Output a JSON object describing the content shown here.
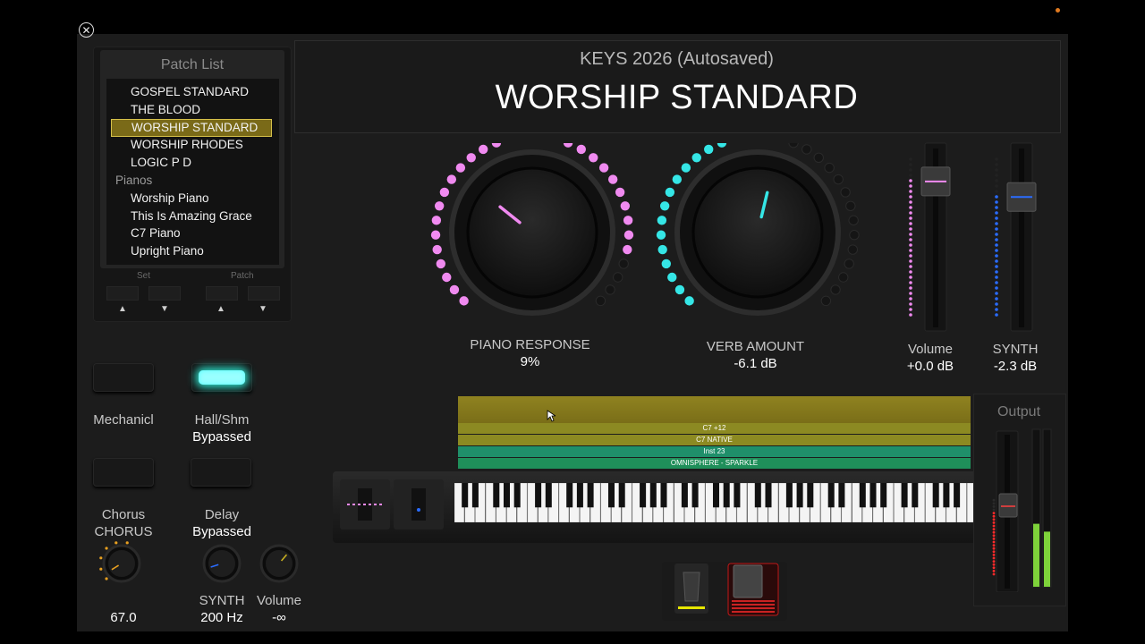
{
  "project_title": "KEYS 2026 (Autosaved)",
  "patch_name": "WORSHIP STANDARD",
  "patch_list": {
    "title": "Patch List",
    "items": [
      {
        "label": "GOSPEL STANDARD",
        "type": "item"
      },
      {
        "label": "THE BLOOD",
        "type": "item"
      },
      {
        "label": "WORSHIP STANDARD",
        "type": "item",
        "selected": true
      },
      {
        "label": "WORSHIP RHODES",
        "type": "item"
      },
      {
        "label": "LOGIC P D",
        "type": "item"
      },
      {
        "label": "Pianos",
        "type": "group"
      },
      {
        "label": "Worship Piano",
        "type": "item"
      },
      {
        "label": "This Is Amazing Grace",
        "type": "item"
      },
      {
        "label": "C7 Piano",
        "type": "item"
      },
      {
        "label": "Upright Piano",
        "type": "item"
      }
    ],
    "set_label": "Set",
    "patch_label": "Patch",
    "up_glyph": "▲",
    "down_glyph": "▼"
  },
  "knobs": {
    "piano_response": {
      "label": "PIANO RESPONSE",
      "value": "9%",
      "level": 0.09,
      "color": "#f08af0"
    },
    "verb_amount": {
      "label": "VERB AMOUNT",
      "value": "-6.1 dB",
      "level": 0.55,
      "color": "#35e6e6"
    }
  },
  "faders": {
    "volume": {
      "label": "Volume",
      "value": "+0.0 dB",
      "level": 0.88,
      "color": "#f08af0"
    },
    "synth": {
      "label": "SYNTH",
      "value": "-2.3 dB",
      "level": 0.78,
      "color": "#2a6cff"
    }
  },
  "effects": {
    "mechanicl": {
      "label": "Mechanicl",
      "status": ""
    },
    "hall_shm": {
      "label": "Hall/Shm",
      "status": "Bypassed",
      "active": true
    },
    "chorus": {
      "label": "Chorus",
      "status": "CHORUS"
    },
    "delay": {
      "label": "Delay",
      "status": "Bypassed"
    }
  },
  "small_knobs": {
    "chorus_amount": {
      "value": "67.0",
      "level": 0.67,
      "color": "#e8a020"
    },
    "synth_cutoff": {
      "label": "SYNTH",
      "value": "200 Hz",
      "level": 0.15,
      "color": "#2a6cff"
    },
    "volume": {
      "label": "Volume",
      "value": "-∞",
      "level": 0.6,
      "color": "#c8b020"
    }
  },
  "layer_stack": {
    "layers": [
      {
        "label": "C7 +12",
        "color": "#8c8a22"
      },
      {
        "label": "C7 NATIVE",
        "color": "#8c8a22"
      },
      {
        "label": "Inst 23",
        "color": "#1f8f6a"
      },
      {
        "label": "OMNISPHERE - SPARKLE",
        "color": "#1f8f5a"
      }
    ],
    "top_color": "#8a7d1e"
  },
  "output": {
    "label": "Output",
    "meter_left": 0.4,
    "meter_right": 0.35
  }
}
